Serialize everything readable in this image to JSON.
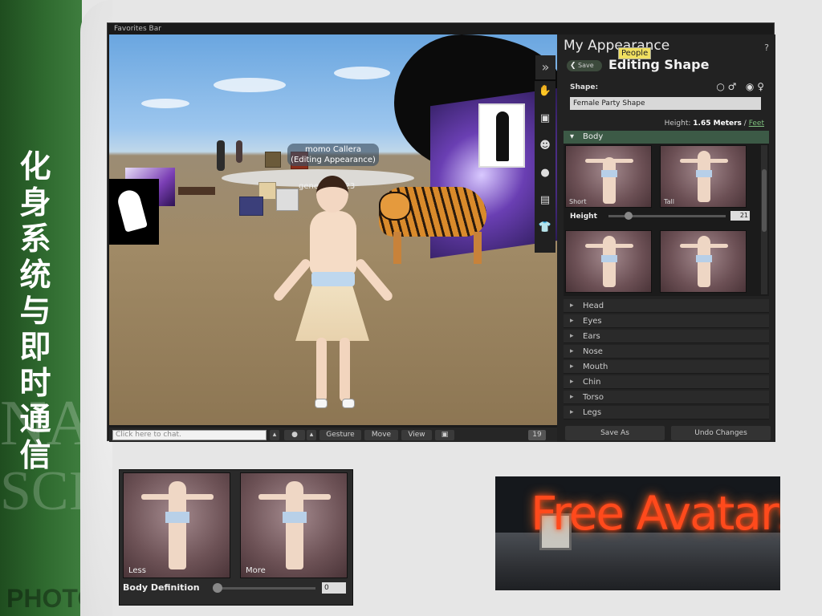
{
  "slide": {
    "vertical_title": "化身系统与即时通信",
    "watermark_1": "NA",
    "watermark_2": "SCI",
    "watermark_3": "PHOTO"
  },
  "viewer": {
    "favorites_bar": "Favorites Bar",
    "scene": {
      "name_tag_line1": "momo Callera",
      "name_tag_line2": "(Editing Appearance)",
      "object_label": "generation 23"
    },
    "side_toolbar": {
      "expand_icon": "double-chevron-right-icon",
      "items": [
        "hand-icon",
        "profile-card-icon",
        "people-icon",
        "chat-bubble-icon",
        "map-icon",
        "shirt-icon"
      ]
    },
    "bottom_bar": {
      "chat_placeholder": "Click here to chat.",
      "gesture": "Gesture",
      "move": "Move",
      "view": "View",
      "counter": "19"
    }
  },
  "appearance_panel": {
    "title": "My Appearance",
    "help": "?",
    "tooltip": "People",
    "back_label": "Save",
    "subtitle": "Editing Shape",
    "shape_label": "Shape:",
    "shape_value": "Female Party Shape",
    "gender_male": "♂",
    "gender_female": "♀",
    "height_prefix": "Height:",
    "height_value": "1.65 Meters",
    "height_sep": "/",
    "height_link": "Feet",
    "body_section": "Body",
    "thumb_short": "Short",
    "thumb_tall": "Tall",
    "height_slider_label": "Height",
    "height_slider_value": "21",
    "height_slider_fraction": 0.21,
    "categories": [
      "Head",
      "Eyes",
      "Ears",
      "Nose",
      "Mouth",
      "Chin",
      "Torso",
      "Legs"
    ],
    "save_as": "Save As",
    "undo": "Undo Changes"
  },
  "inset": {
    "less": "Less",
    "more": "More",
    "label": "Body Definition",
    "value": "0"
  },
  "sign": {
    "text": "Free Avatars"
  },
  "colors": {
    "slide_green": "#2f6a2f",
    "panel_bg": "#222222",
    "section_green": "#3c5a46",
    "link_green": "#7fc07f",
    "neon": "#ff4a1c"
  }
}
